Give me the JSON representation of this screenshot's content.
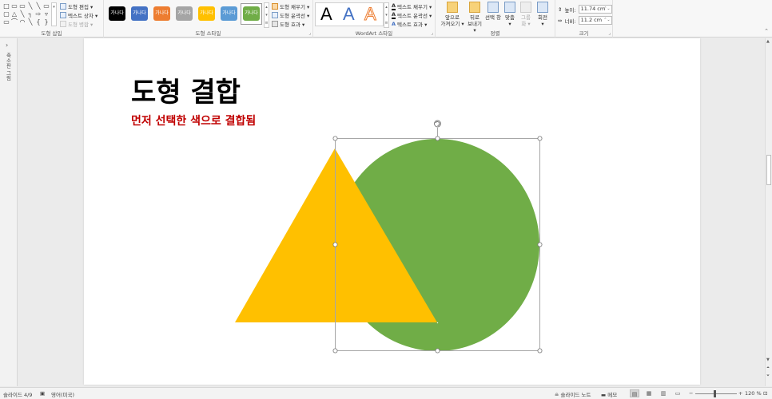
{
  "ribbon": {
    "shape_insert": {
      "label": "도형 삽입",
      "shapes": [
        "□",
        "▭",
        "▭",
        "╲",
        "╲",
        "▭",
        "▢",
        "△",
        "╲",
        "┐",
        "⇨",
        "▿",
        "▭",
        "⌒",
        "◠",
        "╲",
        "{",
        "}"
      ],
      "scroll": "▾",
      "edit_shape": "도형 편집 ▾",
      "text_box": "텍스트 상자 ▾",
      "merge_shapes": "도형 병합 ▾"
    },
    "shape_styles": {
      "label": "도형 스타일",
      "swatch_text": "가나다",
      "swatches": [
        "#000000",
        "#4472c4",
        "#ed7d31",
        "#a5a5a5",
        "#ffc000",
        "#5b9bd5",
        "#70ad47"
      ],
      "fill": "도형 채우기 ▾",
      "outline": "도형 윤곽선 ▾",
      "effects": "도형 효과 ▾",
      "launcher": "⌟"
    },
    "wordart": {
      "label": "WordArt 스타일",
      "letter": "A",
      "text_fill": "텍스트 채우기 ▾",
      "text_outline": "텍스트 윤곽선 ▾",
      "text_effects": "텍스트 효과 ▾",
      "launcher": "⌟"
    },
    "arrange": {
      "label": "정렬",
      "bring_forward": [
        "앞으로",
        "가져오기 ▾"
      ],
      "send_backward": [
        "뒤로",
        "보내기 ▾"
      ],
      "selection_pane": "선택 창",
      "align": [
        "맞춤",
        "▾"
      ],
      "group": [
        "그룹",
        "화 ▾"
      ],
      "rotate": [
        "회전",
        "▾"
      ]
    },
    "size": {
      "label": "크기",
      "height_label": "높이:",
      "height_value": "11.74 cm",
      "width_label": "너비:",
      "width_value": "11.2 cm",
      "launcher": "⌟"
    },
    "collapse": "⌃"
  },
  "thumbnail_panel": {
    "arrow": "›",
    "label": "축소판 그림"
  },
  "slide": {
    "title": "도형 결합",
    "subtitle": "먼저 선택한 색으로 결합됨",
    "colors": {
      "triangle": "#ffc000",
      "circle": "#70ad47",
      "title": "#000000",
      "subtitle": "#c00000"
    }
  },
  "statusbar": {
    "slide_info": "슬라이드 4/9",
    "spell_icon": "spell-check-icon",
    "language": "영어(미국)",
    "notes_pane": "슬라이드 노트",
    "comments": "메모",
    "zoom_minus": "−",
    "zoom_plus": "+",
    "zoom_level": "120 %",
    "fit": "⊡"
  }
}
